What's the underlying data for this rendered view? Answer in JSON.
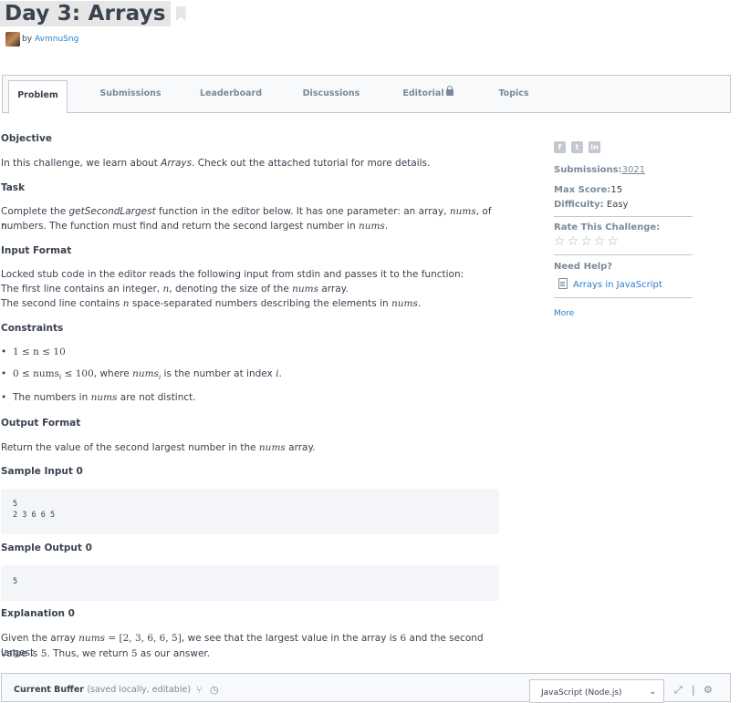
{
  "header": {
    "title": "Day 3: Arrays",
    "by": "by",
    "author": "AvmnuSng"
  },
  "tabs": [
    {
      "label": "Problem"
    },
    {
      "label": "Submissions"
    },
    {
      "label": "Leaderboard"
    },
    {
      "label": "Discussions"
    },
    {
      "label": "Editorial"
    },
    {
      "label": "Topics"
    }
  ],
  "problem": {
    "objective_heading": "Objective",
    "objective_text_1": "In this challenge, we learn about ",
    "objective_em": "Arrays",
    "objective_text_2": ". Check out the attached tutorial for more details.",
    "task_heading": "Task",
    "task_1": "Complete the ",
    "task_fn": "getSecondLargest",
    "task_2": " function in the editor below. It has one parameter: an array, ",
    "task_nums": "nums",
    "task_3": ", of ",
    "task_n": "n",
    "task_4": "numbers. The function must find and return the second largest number in ",
    "task_nums2": "nums",
    "task_5": ".",
    "input_heading": "Input Format",
    "input_1": "Locked stub code in the editor reads the following input from stdin and passes it to the function:",
    "input_2a": "The first line contains an integer, ",
    "input_2n": "n",
    "input_2b": ", denoting the size of the ",
    "input_2nums": "nums",
    "input_2c": " array.",
    "input_3a": "The second line contains ",
    "input_3n": "n",
    "input_3b": " space-separated numbers describing the elements in ",
    "input_3nums": "nums",
    "input_3c": ".",
    "constraints_heading": "Constraints",
    "c1": "1 ≤ n ≤ 10",
    "c2a": "0 ≤ nums",
    "c2sub": "i",
    "c2b": " ≤ 100",
    "c2c": ", where ",
    "c2d": "nums",
    "c2dsub": "i",
    "c2e": " is the number at index ",
    "c2i": "i",
    "c2f": ".",
    "c3a": "The numbers in ",
    "c3nums": "nums",
    "c3b": " are not distinct.",
    "output_heading": "Output Format",
    "output_1": "Return the value of the second largest number in the ",
    "output_nums": "nums",
    "output_2": " array.",
    "sample_input_heading": "Sample Input 0",
    "sample_input_line1": "5",
    "sample_input_line2": "2 3 6 6 5",
    "sample_output_heading": "Sample Output 0",
    "sample_output_line1": "5",
    "explanation_heading": "Explanation 0",
    "exp_1": "Given the array ",
    "exp_nums": "nums",
    "exp_arr": " = [2, 3, 6, 6, 5]",
    "exp_2": ", we see that the largest value in the array is ",
    "exp_6": "6",
    "exp_3": " and the second largest",
    "exp_4": "value is ",
    "exp_5v": "5",
    "exp_6t": ". Thus, we return ",
    "exp_5v2": "5",
    "exp_7": " as our answer."
  },
  "sidebar": {
    "social": [
      "f",
      "t",
      "in"
    ],
    "submissions_label": "Submissions:",
    "submissions_value": "3021",
    "max_score_label": "Max Score:",
    "max_score_value": "15",
    "difficulty_label": "Difficulty:",
    "difficulty_value": "Easy",
    "rate_label": "Rate This Challenge:",
    "need_help_label": "Need Help?",
    "tutorial_link": "Arrays in JavaScript",
    "more_link": "More"
  },
  "editor": {
    "buffer_label": "Current Buffer",
    "buffer_note": "(saved locally, editable)",
    "language": "JavaScript (Node.js)"
  }
}
